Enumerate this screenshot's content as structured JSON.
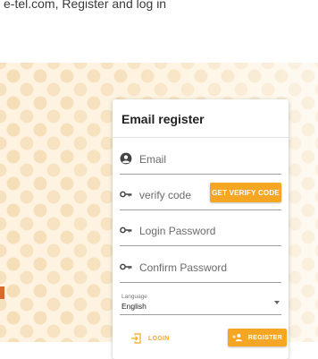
{
  "intro": {
    "text": "e-tel.com, Register and log in"
  },
  "card": {
    "title": "Email register",
    "email_label": "Email",
    "verify_label": "verify code",
    "get_verify_code": "GET VERIFY CODE",
    "login_password_label": "Login Password",
    "confirm_password_label": "Confirm Password",
    "language_caption": "Language",
    "language_value": "English",
    "login_label": "LOGIN",
    "register_label": "REGISTER"
  },
  "colors": {
    "accent": "#f5a623",
    "hero_bg": "#fdf3e0",
    "hero_dot": "#eecc96",
    "side_accent": "#d56a2c"
  },
  "icons": [
    "account-icon",
    "key-icon",
    "chevron-down-icon",
    "login-icon",
    "person-add-icon"
  ]
}
